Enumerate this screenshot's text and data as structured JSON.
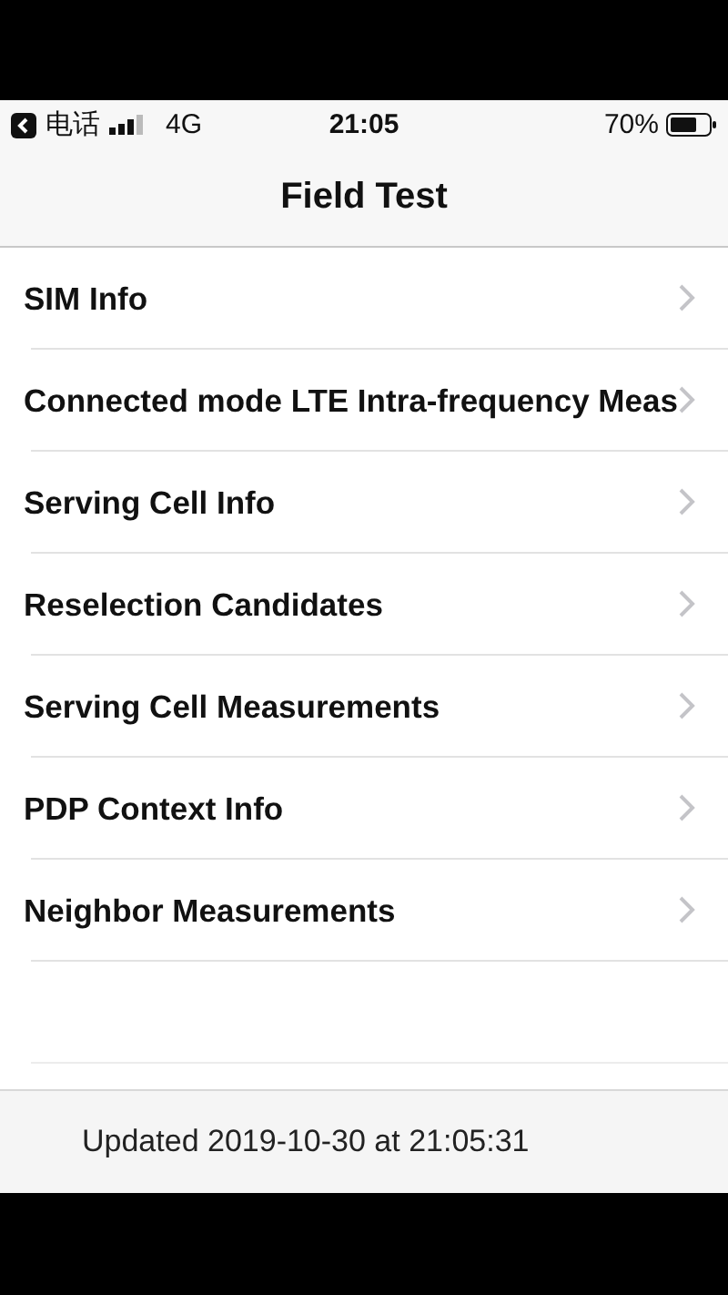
{
  "status_bar": {
    "back_label": "电话",
    "network": "4G",
    "time": "21:05",
    "battery": "70%"
  },
  "nav_bar": {
    "title": "Field Test"
  },
  "items": [
    {
      "label": "SIM Info"
    },
    {
      "label": "Connected mode LTE Intra-frequency Meas"
    },
    {
      "label": "Serving Cell Info"
    },
    {
      "label": "Reselection Candidates"
    },
    {
      "label": "Serving Cell Measurements"
    },
    {
      "label": "PDP Context Info"
    },
    {
      "label": "Neighbor Measurements"
    }
  ],
  "footer": {
    "text": "Updated 2019-10-30 at 21:05:31"
  }
}
